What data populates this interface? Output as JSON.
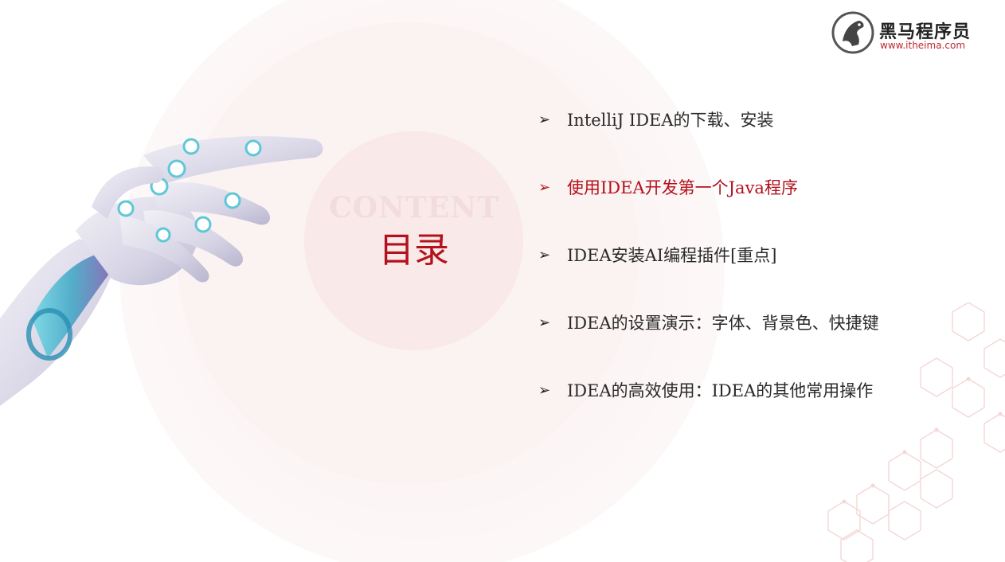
{
  "logo": {
    "title": "黑马程序员",
    "url": "www.itheima.com"
  },
  "heading": {
    "en": "CONTENT",
    "cn": "目录"
  },
  "menu": {
    "bullet": "➢",
    "items": [
      {
        "label": "IntelliJ IDEA的下载、安装"
      },
      {
        "label": "使用IDEA开发第一个Java程序"
      },
      {
        "label": "IDEA安装AI编程插件[重点]"
      },
      {
        "label": "IDEA的设置演示：字体、背景色、快捷键"
      },
      {
        "label": "IDEA的高效使用：IDEA的其他常用操作"
      }
    ],
    "active_index": 1
  },
  "colors": {
    "accent": "#b3121c",
    "text": "#2a2a2a",
    "heading_en": "#f3dcdc"
  }
}
